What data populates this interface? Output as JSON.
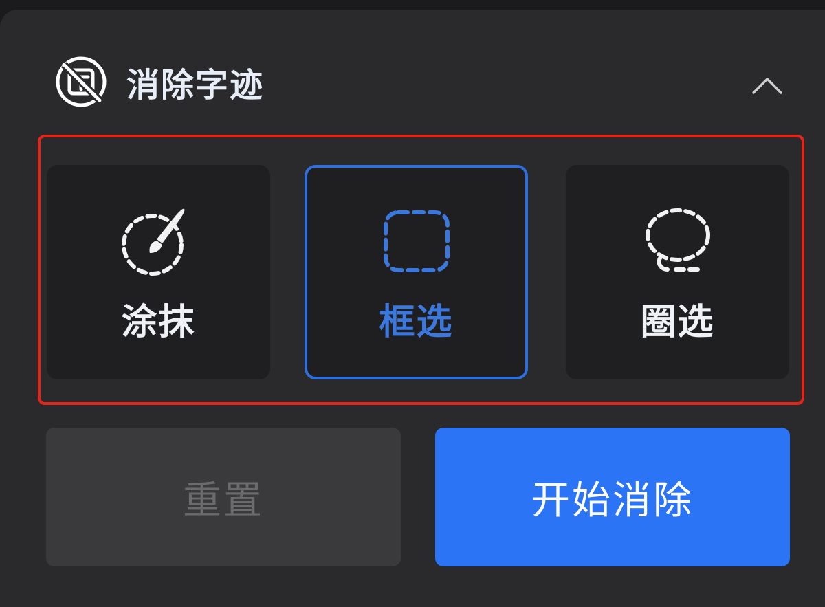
{
  "header": {
    "title": "消除字迹",
    "icon": "text-erase-icon",
    "collapse_icon": "chevron-up-icon"
  },
  "modes": [
    {
      "label": "涂抹",
      "icon": "brush-smear-icon",
      "selected": false
    },
    {
      "label": "框选",
      "icon": "dashed-rectangle-icon",
      "selected": true
    },
    {
      "label": "圈选",
      "icon": "lasso-icon",
      "selected": false
    }
  ],
  "actions": {
    "reset_label": "重置",
    "start_label": "开始消除"
  },
  "colors": {
    "accent": "#2b74f5",
    "selected_border": "#2e6fdb",
    "highlight": "#e0261b",
    "panel": "#2a2a2c"
  }
}
